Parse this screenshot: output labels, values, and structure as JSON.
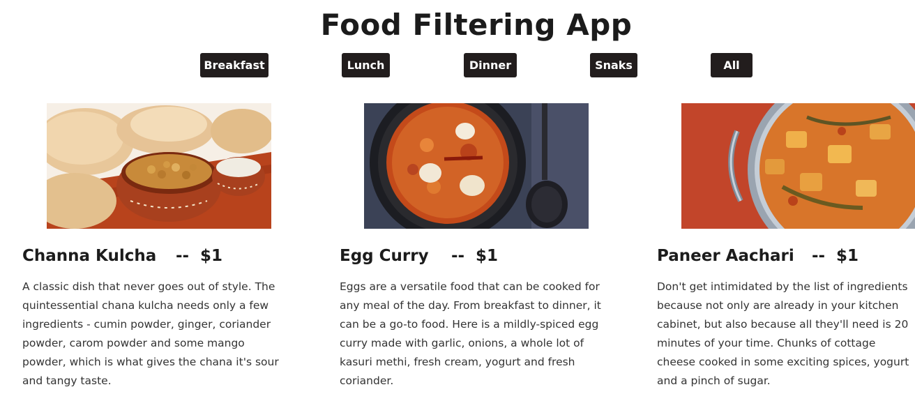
{
  "header": {
    "title": "Food Filtering App"
  },
  "filters": [
    {
      "label": "Breakfast"
    },
    {
      "label": "Lunch"
    },
    {
      "label": "Dinner"
    },
    {
      "label": "Snaks"
    },
    {
      "label": "All"
    }
  ],
  "menu": [
    {
      "name": "Channa Kulcha",
      "separator": "--",
      "price": "$1",
      "description": "A classic dish that never goes out of style. The quintessential chana kulcha needs only a few ingredients - cumin powder, ginger, coriander powder, carom powder and some mango powder, which is what gives the chana it's sour and tangy taste.",
      "image_alt": "channa-kulcha-photo"
    },
    {
      "name": "Egg Curry",
      "separator": "--",
      "price": "$1",
      "description": "Eggs are a versatile food that can be cooked for any meal of the day. From breakfast to dinner, it can be a go-to food. Here is a mildly-spiced egg curry made with garlic, onions, a whole lot of kasuri methi, fresh cream, yogurt and fresh coriander.",
      "image_alt": "egg-curry-photo"
    },
    {
      "name": "Paneer Aachari",
      "separator": "--",
      "price": "$1",
      "description": "Don't get intimidated by the list of ingredients because not only are already in your kitchen cabinet, but also because all they'll need is 20 minutes of your time. Chunks of cottage cheese cooked in some exciting spices, yogurt and a pinch of sugar.",
      "image_alt": "paneer-aachari-photo"
    }
  ],
  "colors": {
    "button_bg": "#221d1d",
    "button_text": "#ffffff",
    "title_text": "#1b1b1b",
    "body_text": "#333333"
  }
}
